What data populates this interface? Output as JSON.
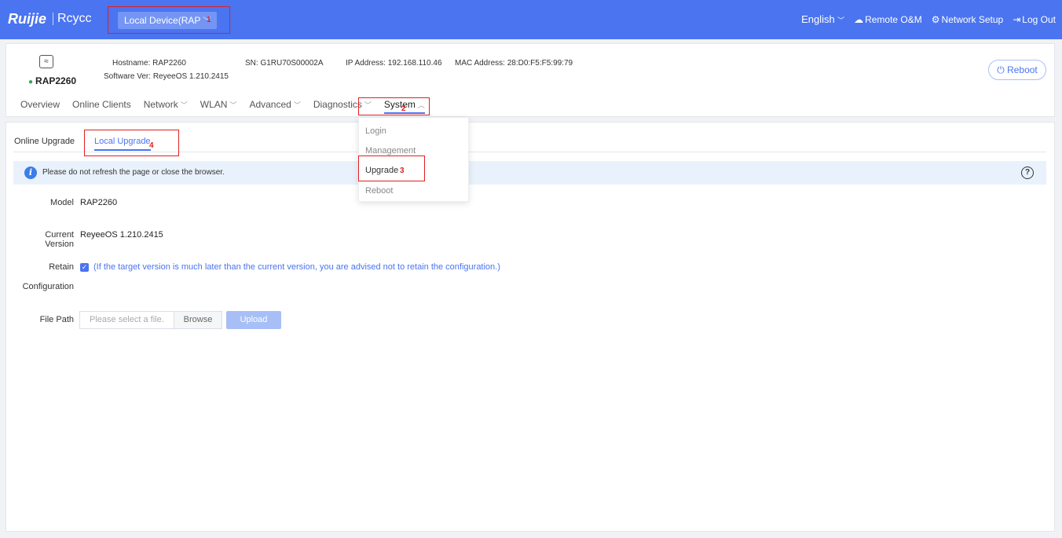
{
  "topbar": {
    "logo": "Ruijie",
    "logo2": "Rcycc",
    "device_selector": "Local Device(RAP",
    "language": "English",
    "remote": "Remote O&M",
    "network_setup": "Network Setup",
    "logout": "Log Out"
  },
  "device": {
    "name": "RAP2260",
    "hostname_label": "Hostname:",
    "hostname": "RAP2260",
    "software_label": "Software Ver:",
    "software": "ReyeeOS 1.210.2415",
    "sn_label": "SN:",
    "sn": "G1RU70S00002A",
    "ip_label": "IP Address:",
    "ip": "192.168.110.46",
    "mac_label": "MAC Address:",
    "mac": "28:D0:F5:F5:99:79",
    "reboot": "Reboot"
  },
  "nav": {
    "overview": "Overview",
    "clients": "Online Clients",
    "network": "Network",
    "wlan": "WLAN",
    "advanced": "Advanced",
    "diagnostics": "Diagnostics",
    "system": "System"
  },
  "dropdown": {
    "login": "Login",
    "management": "Management",
    "upgrade": "Upgrade",
    "reboot": "Reboot"
  },
  "tabs": {
    "online": "Online Upgrade",
    "local": "Local Upgrade"
  },
  "alert": "Please do not refresh the page or close the browser.",
  "form": {
    "model_label": "Model",
    "model": "RAP2260",
    "version_label": "Current Version",
    "version": "ReyeeOS 1.210.2415",
    "retain_label": "Retain",
    "retain_label2": "Configuration",
    "retain_note": "(If the target version is much later than the current version, you are advised not to retain the configuration.)",
    "filepath_label": "File Path",
    "file_placeholder": "Please select a file.",
    "browse": "Browse",
    "upload": "Upload"
  },
  "steps": {
    "s1": "1",
    "s2": "2",
    "s3": "3",
    "s4": "4"
  }
}
